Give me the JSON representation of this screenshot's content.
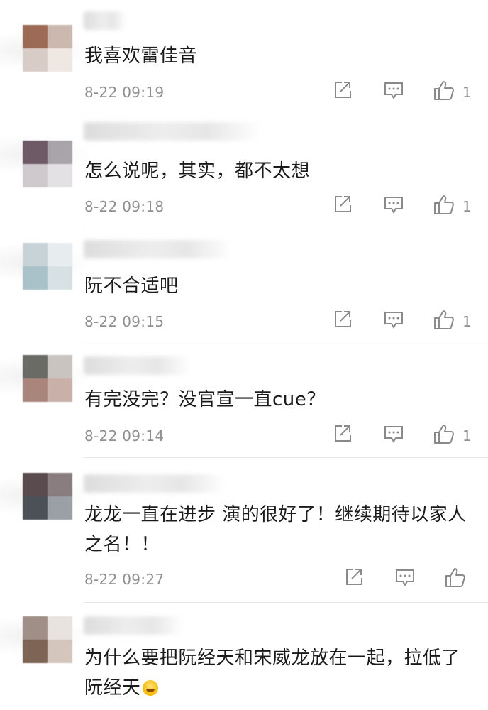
{
  "comments": [
    {
      "text": "我喜欢雷佳音",
      "time": "8-22 09:19",
      "likes": "1",
      "avatar_colors": [
        "#9c6a55",
        "#cbb8ae",
        "#d8cdc6",
        "#efe7e2"
      ]
    },
    {
      "text": "怎么说呢，其实，都不太想",
      "time": "8-22 09:18",
      "likes": "1",
      "avatar_colors": [
        "#6e5a66",
        "#a9a3aa",
        "#cfc9cd",
        "#e3e1e3"
      ]
    },
    {
      "text": "阮不合适吧",
      "time": "8-22 09:15",
      "likes": "1",
      "avatar_colors": [
        "#c8d3d8",
        "#e7ecee",
        "#a9c1c9",
        "#d7e1e4"
      ]
    },
    {
      "text": "有完没完？没官宣一直cue？",
      "time": "8-22 09:14",
      "likes": "1",
      "avatar_colors": [
        "#6a6a66",
        "#c9c4bf",
        "#a9857b",
        "#c9b1aa"
      ]
    },
    {
      "text": "龙龙一直在进步 演的很好了！继续期待以家人之名！！",
      "time": "8-22 09:27",
      "likes": "",
      "avatar_colors": [
        "#5a4b4e",
        "#8a7d7f",
        "#4c5157",
        "#9aa0a6"
      ]
    },
    {
      "text": "为什么要把阮经天和宋威龙放在一起，拉低了阮经天",
      "time": "",
      "likes": "",
      "avatar_colors": [
        "#9f8f86",
        "#e8e3df",
        "#7d6454",
        "#d4c6bc"
      ]
    }
  ],
  "icons": {
    "share": "share-icon",
    "comment": "comment-icon",
    "like": "thumbs-up-icon",
    "emoji": "laughing-tears-emoji"
  },
  "colors": {
    "text": "#1a1a1a",
    "meta": "#8f8f8f",
    "divider": "#e6e6e6"
  }
}
